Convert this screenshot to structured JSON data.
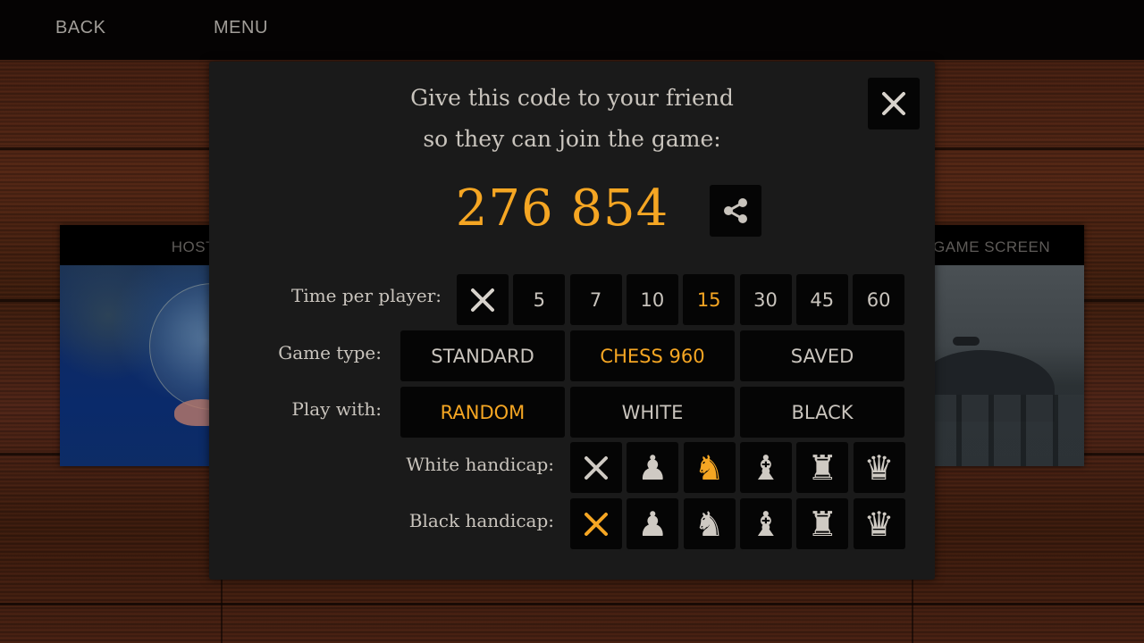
{
  "topbar": {
    "back_label": "BACK",
    "menu_label": "MENU"
  },
  "cards": {
    "host": {
      "title": "HOST"
    },
    "game": {
      "title": "GAME SCREEN"
    }
  },
  "dialog": {
    "message_line1": "Give this code to your friend",
    "message_line2": "so they can join the game:",
    "code": "276 854",
    "close_icon": "close-icon",
    "share_icon": "share-icon"
  },
  "colors": {
    "accent": "#f5a623",
    "text": "#c9c4bd",
    "panel": "#1a1a1a",
    "cell": "#050505"
  },
  "time_per_player": {
    "label": "Time per player:",
    "options": [
      {
        "label": "✕",
        "icon": "none-icon",
        "selected": false
      },
      {
        "label": "5",
        "selected": false
      },
      {
        "label": "7",
        "selected": false
      },
      {
        "label": "10",
        "selected": false
      },
      {
        "label": "15",
        "selected": true
      },
      {
        "label": "30",
        "selected": false
      },
      {
        "label": "45",
        "selected": false
      },
      {
        "label": "60",
        "selected": false
      }
    ]
  },
  "game_type": {
    "label": "Game type:",
    "options": [
      {
        "label": "STANDARD",
        "selected": false
      },
      {
        "label": "CHESS 960",
        "selected": true
      },
      {
        "label": "SAVED",
        "selected": false
      }
    ]
  },
  "play_with": {
    "label": "Play with:",
    "options": [
      {
        "label": "RANDOM",
        "selected": true
      },
      {
        "label": "WHITE",
        "selected": false
      },
      {
        "label": "BLACK",
        "selected": false
      }
    ]
  },
  "white_handicap": {
    "label": "White handicap:",
    "options": [
      {
        "piece": "none",
        "selected": false
      },
      {
        "piece": "pawn",
        "selected": false
      },
      {
        "piece": "knight",
        "selected": true
      },
      {
        "piece": "bishop",
        "selected": false
      },
      {
        "piece": "rook",
        "selected": false
      },
      {
        "piece": "queen",
        "selected": false
      }
    ]
  },
  "black_handicap": {
    "label": "Black handicap:",
    "options": [
      {
        "piece": "none",
        "selected": true
      },
      {
        "piece": "pawn",
        "selected": false
      },
      {
        "piece": "knight",
        "selected": false
      },
      {
        "piece": "bishop",
        "selected": false
      },
      {
        "piece": "rook",
        "selected": false
      },
      {
        "piece": "queen",
        "selected": false
      }
    ]
  }
}
